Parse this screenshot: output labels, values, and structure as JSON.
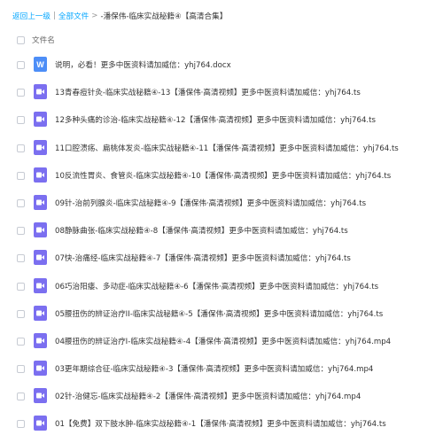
{
  "breadcrumb": {
    "back": "返回上一级",
    "separator": "|",
    "all_files": "全部文件",
    "arrow": ">",
    "current": "-潘保伟-临床实战秘籍④【高清合集】"
  },
  "header": {
    "column_label": "文件名"
  },
  "icons": {
    "doc": "word-document-icon",
    "video": "video-file-icon"
  },
  "colors": {
    "link": "#06a7ff",
    "word_icon": "#4d8ef7",
    "video_icon": "#7b6ff0"
  },
  "files": [
    {
      "type": "doc",
      "name": "说明，必看！更多中医资料请加威信：yhj764.docx"
    },
    {
      "type": "video",
      "name": "13青春痘针灸-临床实战秘籍④-13【潘保伟·高清视频】更多中医资料请加威信：yhj764.ts"
    },
    {
      "type": "video",
      "name": "12多种头痛的诊治-临床实战秘籍④-12【潘保伟·高清视频】更多中医资料请加威信：yhj764.ts"
    },
    {
      "type": "video",
      "name": "11口腔溃疡、扁桃体发炎-临床实战秘籍④-11【潘保伟·高清视频】更多中医资料请加威信：yhj764.ts"
    },
    {
      "type": "video",
      "name": "10反流性胃炎、食管炎-临床实战秘籍④-10【潘保伟·高清视频】更多中医资料请加威信：yhj764.ts"
    },
    {
      "type": "video",
      "name": "09针-治前列腺炎-临床实战秘籍④-9【潘保伟·高清视频】更多中医资料请加威信：yhj764.ts"
    },
    {
      "type": "video",
      "name": "08静脉曲张-临床实战秘籍④-8【潘保伟·高清视频】更多中医资料请加威信：yhj764.ts"
    },
    {
      "type": "video",
      "name": "07快-治痛经-临床实战秘籍④-7【潘保伟·高清视频】更多中医资料请加威信：yhj764.ts"
    },
    {
      "type": "video",
      "name": "06巧治阳痿、多动症-临床实战秘籍④-6【潘保伟·高清视频】更多中医资料请加威信：yhj764.ts"
    },
    {
      "type": "video",
      "name": "05腰扭伤的辨证治疗II-临床实战秘籍④-5【潘保伟·高清视频】更多中医资料请加威信：yhj764.ts"
    },
    {
      "type": "video",
      "name": "04腰扭伤的辨证治疗I-临床实战秘籍④-4【潘保伟·高清视频】更多中医资料请加威信：yhj764.mp4"
    },
    {
      "type": "video",
      "name": "03更年期综合征-临床实战秘籍④-3【潘保伟·高清视频】更多中医资料请加威信：yhj764.mp4"
    },
    {
      "type": "video",
      "name": "02针-治健忘-临床实战秘籍④-2【潘保伟·高清视频】更多中医资料请加威信：yhj764.mp4"
    },
    {
      "type": "video",
      "name": "01【免费】双下肢水肿-临床实战秘籍④-1【潘保伟·高清视频】更多中医资料请加威信：yhj764.ts"
    }
  ]
}
